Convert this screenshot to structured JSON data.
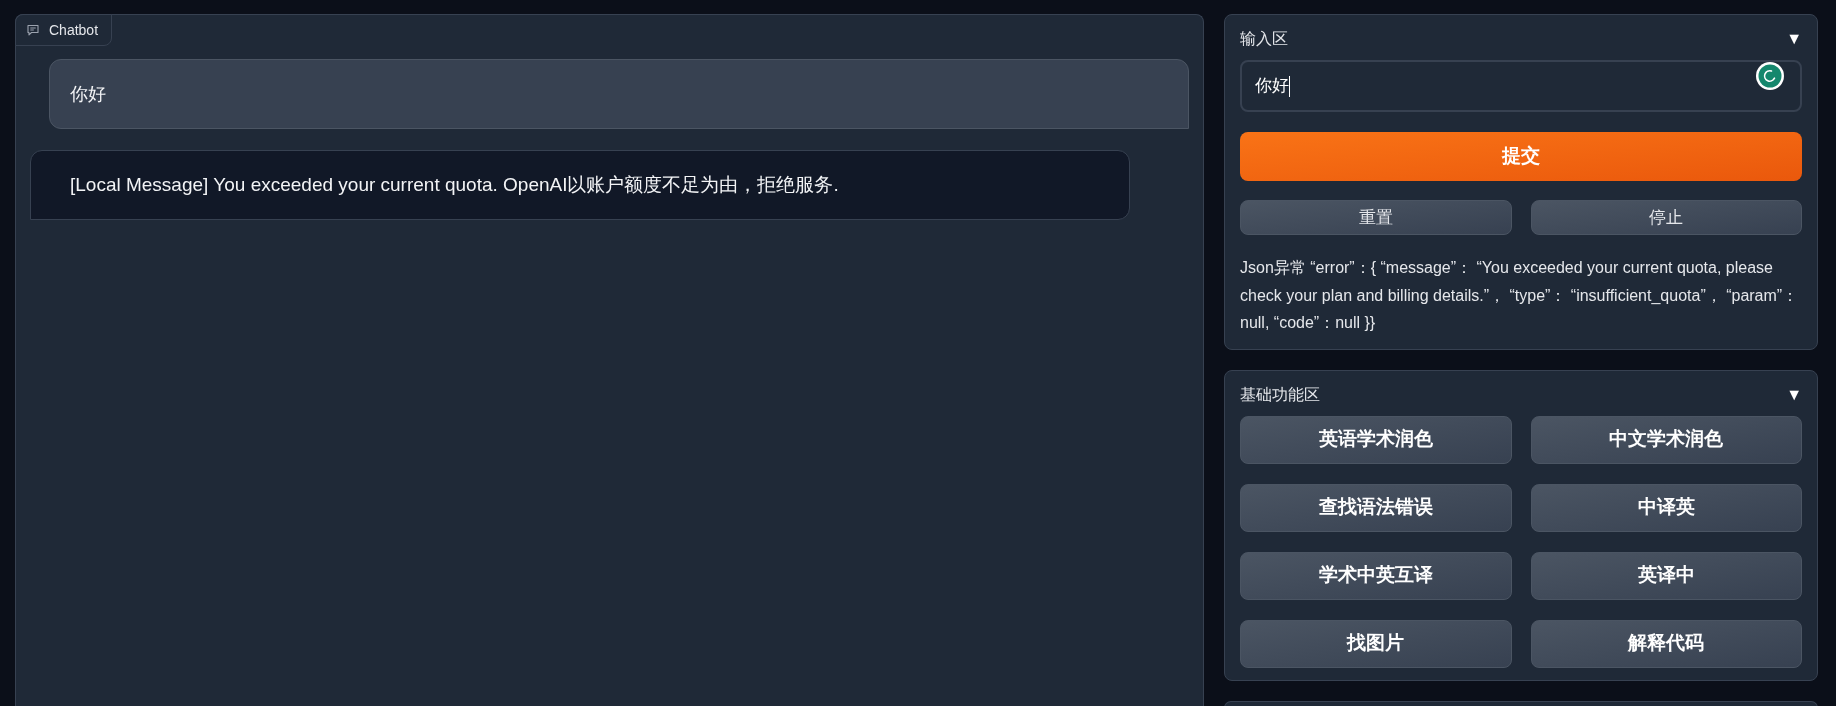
{
  "chatbot": {
    "label": "Chatbot",
    "messages": [
      {
        "kind": "user",
        "text": "你好"
      },
      {
        "kind": "bot",
        "text": "[Local Message] You exceeded your current quota. OpenAI以账户额度不足为由，拒绝服务."
      }
    ]
  },
  "input_panel": {
    "title": "输入区",
    "toggle": "▼",
    "input": {
      "value": "你好"
    },
    "submit_button": "提交",
    "buttons": [
      "重置",
      "停止"
    ],
    "status_text": "Json异常 “error”：{ “message”： “You exceeded your current quota, please check your plan and billing details.”， “type”： “insufficient_quota”， “param”：null, “code”：null }}"
  },
  "function_panel": {
    "title": "基础功能区",
    "toggle": "▼",
    "buttons": [
      "英语学术润色",
      "中文学术润色",
      "查找语法错误",
      "中译英",
      "学术中英互译",
      "英译中",
      "找图片",
      "解释代码"
    ]
  }
}
